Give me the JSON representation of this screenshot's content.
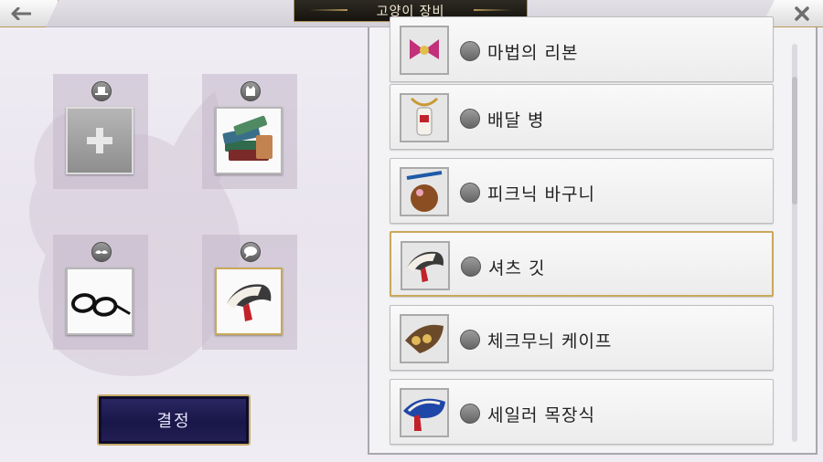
{
  "header": {
    "title": "고양이 장비"
  },
  "icons": {
    "back": "arrow-left-icon",
    "close": "close-x-icon",
    "hat_slot": "hat-icon",
    "head_slot": "cat-head-icon",
    "face_slot": "mustache-icon",
    "neck_slot": "speech-bubble-icon"
  },
  "equipped_slots": [
    {
      "slot": "hat",
      "item": "empty"
    },
    {
      "slot": "head",
      "item": "books"
    },
    {
      "slot": "face",
      "item": "glasses"
    },
    {
      "slot": "neck",
      "item": "shirt-collar"
    }
  ],
  "decide_button": {
    "label": "결정"
  },
  "items": [
    {
      "name": "마법의 리본",
      "icon": "ribbon-icon"
    },
    {
      "name": "배달 병",
      "icon": "bottle-icon"
    },
    {
      "name": "피크닉 바구니",
      "icon": "basket-icon"
    },
    {
      "name": "셔츠 깃",
      "icon": "collar-icon",
      "selected": true
    },
    {
      "name": "체크무늬 케이프",
      "icon": "cape-icon"
    },
    {
      "name": "세일러 목장식",
      "icon": "sailor-collar-icon"
    }
  ],
  "colors": {
    "gold_border": "#c9a85a",
    "decide_bg": "#1d1a50",
    "title_bg": "#1f1b15"
  }
}
